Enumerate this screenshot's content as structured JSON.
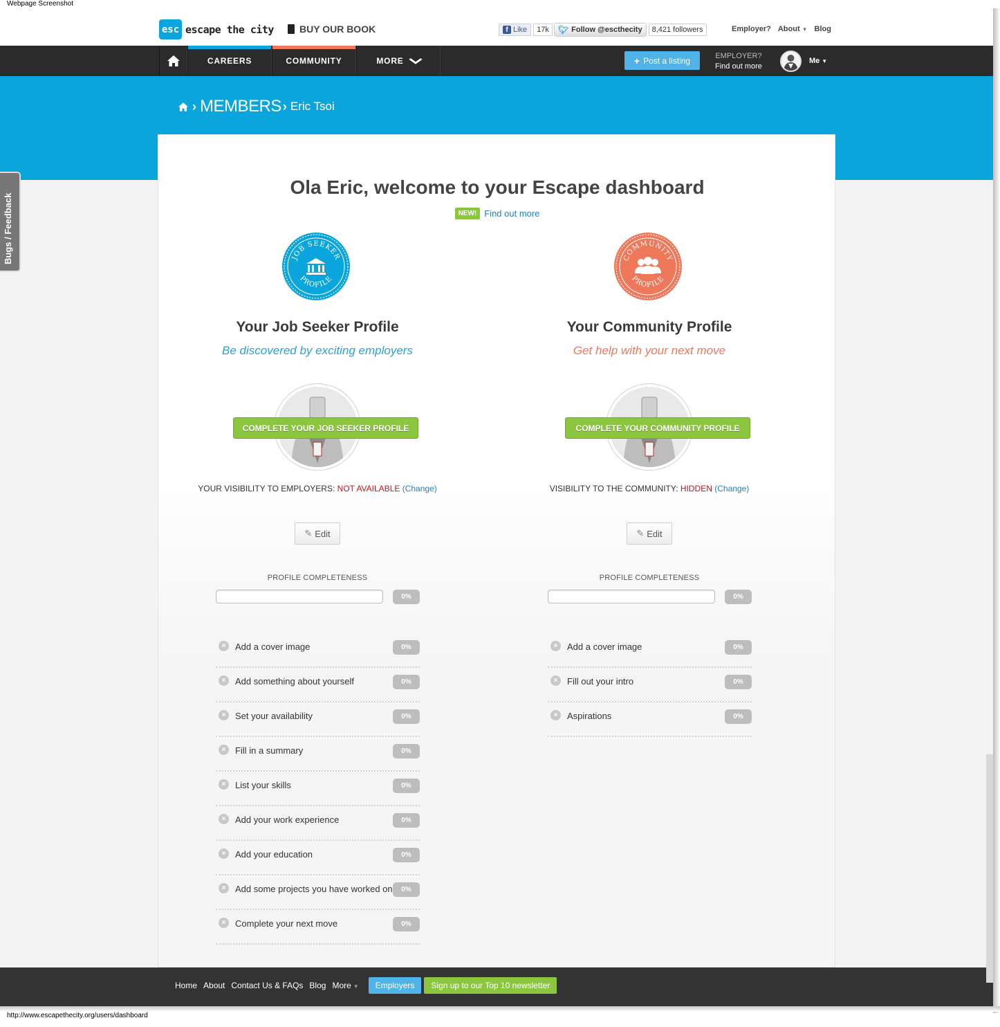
{
  "screenshot_label": "Webpage Screenshot",
  "status_url": "http://www.escapethecity.org/users/dashboard",
  "header": {
    "logo_mark": "esc",
    "logo_text": "escape the city",
    "book_label": "BUY OUR BOOK",
    "fb_like": "Like",
    "fb_count": "17k",
    "tw_follow": "Follow @escthecity",
    "tw_count": "8,421 followers",
    "links": {
      "employer": "Employer?",
      "about": "About",
      "blog": "Blog"
    }
  },
  "nav": {
    "items": [
      {
        "label": "CAREERS"
      },
      {
        "label": "COMMUNITY"
      },
      {
        "label": "MORE"
      }
    ],
    "post_listing": "Post a listing",
    "employer_top": "EMPLOYER?",
    "employer_bottom": "Find out more",
    "me_label": "Me"
  },
  "breadcrumb": {
    "members": "MEMBERS",
    "name": "Eric Tsoi"
  },
  "feedback_tab": "Bugs / Feedback",
  "welcome": {
    "title": "Ola Eric, welcome to your Escape dashboard",
    "new_badge": "NEW!",
    "find_out_more": "Find out more"
  },
  "job_seeker": {
    "badge_top": "JOB SEEKER",
    "badge_bottom": "PROFILE",
    "title": "Your Job Seeker Profile",
    "subtitle": "Be discovered by exciting employers",
    "complete_button": "COMPLETE YOUR JOB SEEKER PROFILE",
    "visibility_label": "YOUR VISIBILITY TO EMPLOYERS:",
    "visibility_value": "NOT AVAILABLE",
    "change_link": "(Change)",
    "edit_label": "Edit",
    "completeness_label": "PROFILE COMPLETENESS",
    "completeness_value": "0%",
    "completeness_fraction": 0,
    "tasks": [
      {
        "label": "Add a cover image",
        "pct": "0%"
      },
      {
        "label": "Add something about yourself",
        "pct": "0%"
      },
      {
        "label": "Set your availability",
        "pct": "0%"
      },
      {
        "label": "Fill in a summary",
        "pct": "0%"
      },
      {
        "label": "List your skills",
        "pct": "0%"
      },
      {
        "label": "Add your work experience",
        "pct": "0%"
      },
      {
        "label": "Add your education",
        "pct": "0%"
      },
      {
        "label": "Add some projects you have worked on",
        "pct": "0%"
      },
      {
        "label": "Complete your next move",
        "pct": "0%"
      }
    ]
  },
  "community": {
    "badge_top": "COMMUNITY",
    "badge_bottom": "PROFILE",
    "title": "Your Community Profile",
    "subtitle": "Get help with your next move",
    "complete_button": "COMPLETE YOUR COMMUNITY PROFILE",
    "visibility_label": "VISIBILITY TO THE COMMUNITY:",
    "visibility_value": "HIDDEN",
    "change_link": "(Change)",
    "edit_label": "Edit",
    "completeness_label": "PROFILE COMPLETENESS",
    "completeness_value": "0%",
    "completeness_fraction": 0,
    "tasks": [
      {
        "label": "Add a cover image",
        "pct": "0%"
      },
      {
        "label": "Fill out your intro",
        "pct": "0%"
      },
      {
        "label": "Aspirations",
        "pct": "0%"
      }
    ]
  },
  "footer": {
    "links": [
      "Home",
      "About",
      "Contact Us & FAQs",
      "Blog"
    ],
    "more": "More",
    "employers": "Employers",
    "newsletter": "Sign up to our Top 10 newsletter"
  },
  "colors": {
    "brand_blue": "#0aa5dc",
    "community_orange": "#f0785a",
    "action_green": "#8cc63f",
    "alert_red": "#c3161c"
  }
}
